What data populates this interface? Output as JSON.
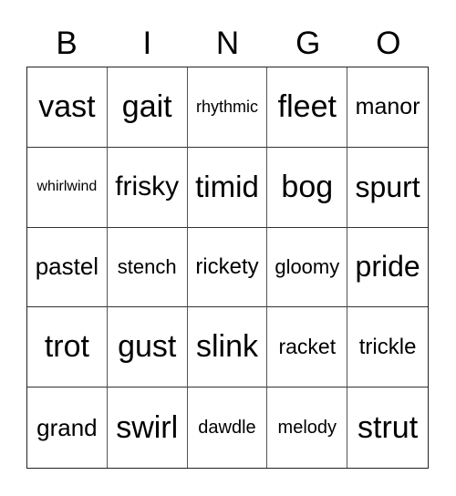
{
  "header": {
    "letters": [
      "B",
      "I",
      "N",
      "G",
      "O"
    ]
  },
  "grid": {
    "rows": [
      [
        "vast",
        "gait",
        "rhythmic",
        "fleet",
        "manor"
      ],
      [
        "whirlwind",
        "frisky",
        "timid",
        "bog",
        "spurt"
      ],
      [
        "pastel",
        "stench",
        "rickety",
        "gloomy",
        "pride"
      ],
      [
        "trot",
        "gust",
        "slink",
        "racket",
        "trickle"
      ],
      [
        "grand",
        "swirl",
        "dawdle",
        "melody",
        "strut"
      ]
    ]
  }
}
